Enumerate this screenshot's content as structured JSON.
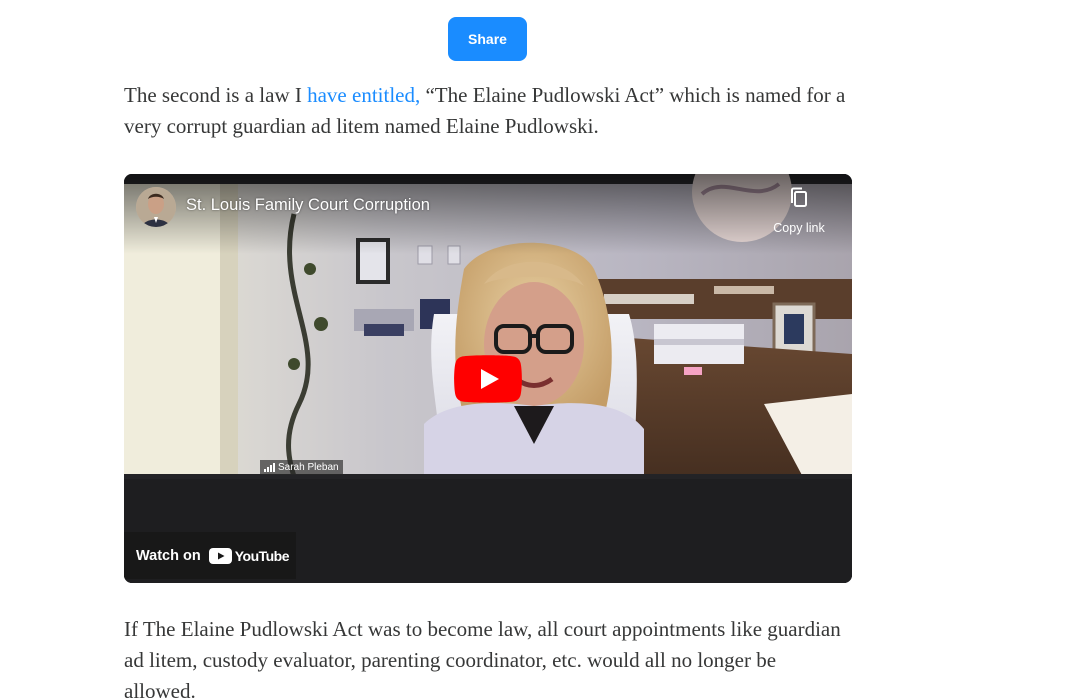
{
  "share": {
    "label": "Share"
  },
  "paragraph_1": {
    "before": "The second is a law I ",
    "link": "have entitled,",
    "after": " “The Elaine Pudlowski Act” which is named for a very corrupt guardian ad litem named Elaine Pudlowski."
  },
  "video": {
    "title": "St. Louis Family Court Corruption",
    "copy_link": "Copy link",
    "participant_name": "Sarah Pleban",
    "watch_on": "Watch on",
    "youtube": "YouTube",
    "icons": {
      "avatar": "channel-avatar",
      "copy": "copy-icon",
      "play": "play-icon",
      "signal": "signal-icon",
      "youtube": "youtube-logo-icon"
    }
  },
  "paragraph_2": {
    "text": "If The Elaine Pudlowski Act was to become law, all court appointments like guardian ad litem, custody evaluator, parenting coordinator, etc. would all no longer be allowed."
  },
  "colors": {
    "accent": "#1a8cff",
    "text": "#363737",
    "youtube_red": "#ff0000"
  }
}
